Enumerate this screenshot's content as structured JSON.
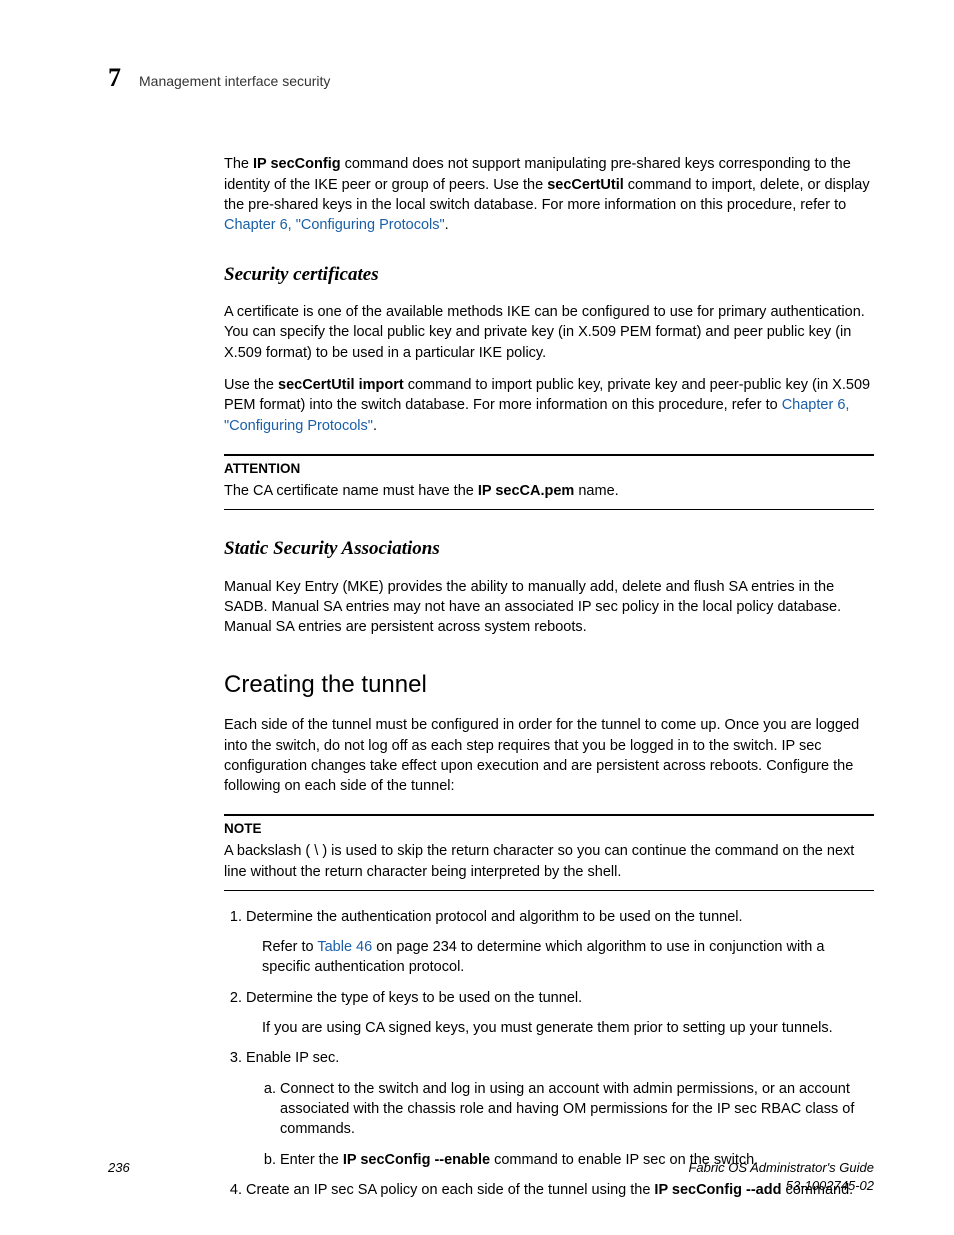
{
  "header": {
    "chapter": "7",
    "title": "Management interface security"
  },
  "intro": {
    "pre1": "The ",
    "cmd1": "IP secConfig",
    "mid1": " command does not support manipulating pre-shared keys corresponding to the identity of the IKE peer or group of peers. Use the ",
    "cmd2": "secCertUtil",
    "mid2": " command to import, delete, or display the pre-shared keys in the local switch database. For more information on this procedure, refer to ",
    "link": "Chapter 6, \"Configuring Protocols\"",
    "post": "."
  },
  "sec_cert": {
    "heading": "Security certificates",
    "p1": "A certificate is one of the available methods IKE can be configured to use for primary authentication. You can specify the local public key and private key (in X.509 PEM format) and peer public key (in X.509 format) to be used in a particular IKE policy.",
    "p2_pre": "Use the ",
    "p2_cmd": "secCertUtil import",
    "p2_mid": " command to import public key, private key and peer-public key (in X.509 PEM format) into the switch database. For more information on this procedure, refer to ",
    "p2_link": "Chapter 6, \"Configuring Protocols\"",
    "p2_post": "."
  },
  "attention": {
    "title": "ATTENTION",
    "pre": "The CA certificate name must have the ",
    "bold": "IP secCA.pem",
    "post": " name."
  },
  "static_sa": {
    "heading": "Static Security Associations",
    "p1": "Manual Key Entry (MKE) provides the ability to manually add, delete and flush SA entries in the SADB. Manual SA entries may not have an associated IP sec policy in the local policy database. Manual SA entries are persistent across system reboots."
  },
  "tunnel": {
    "heading": "Creating the tunnel",
    "p1": "Each side of the tunnel must be configured in order for the tunnel to come up. Once you are logged into the switch, do not log off as each step requires that you be logged in to the switch. IP sec configuration changes take effect upon execution and are persistent across reboots. Configure the following on each side of the tunnel:"
  },
  "note": {
    "title": "NOTE",
    "body": "A backslash ( \\ ) is used to skip the return character so you can continue the command on the next line without the return character being interpreted by the shell."
  },
  "steps": {
    "s1": "Determine the authentication protocol and algorithm to be used on the tunnel.",
    "s1_sub_pre": "Refer to ",
    "s1_sub_link": "Table 46",
    "s1_sub_post": " on page 234 to determine which algorithm to use in conjunction with a specific authentication protocol.",
    "s2": "Determine the type of keys to be used on the tunnel.",
    "s2_sub": "If you are using CA signed keys, you must generate them prior to setting up your tunnels.",
    "s3": "Enable IP sec.",
    "s3a": "Connect to the switch and log in using an account with admin permissions, or an account associated with the chassis role and having OM permissions for the IP sec RBAC class of commands.",
    "s3b_pre": "Enter the ",
    "s3b_cmd": "IP secConfig  --enable",
    "s3b_post": " command to enable IP sec on the switch.",
    "s4_pre": "Create an IP sec SA policy on each side of the tunnel using the ",
    "s4_cmd": "IP secConfig  --add",
    "s4_post": " command."
  },
  "footer": {
    "page": "236",
    "doc_title": "Fabric OS Administrator's Guide",
    "doc_id": "53-1002745-02"
  }
}
